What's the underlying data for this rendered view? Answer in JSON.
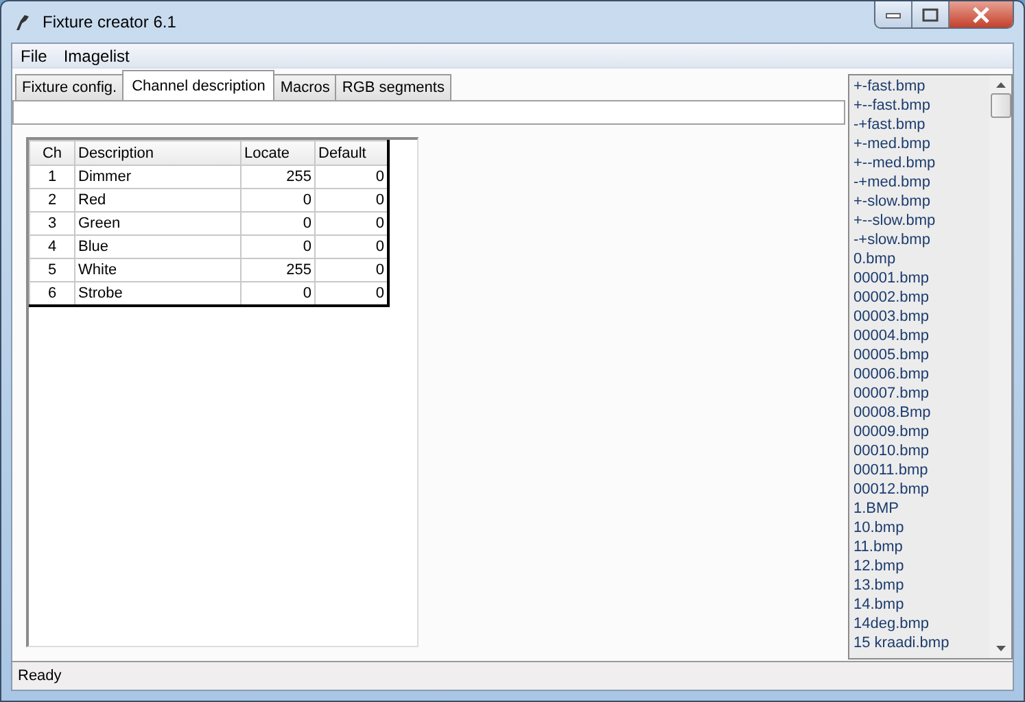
{
  "window": {
    "title": "Fixture creator 6.1"
  },
  "menu": [
    "File",
    "Imagelist"
  ],
  "tabs": [
    {
      "label": "Fixture config.",
      "selected": false
    },
    {
      "label": "Channel description",
      "selected": true
    },
    {
      "label": "Macros",
      "selected": false
    },
    {
      "label": "RGB segments",
      "selected": false
    }
  ],
  "table": {
    "columns": [
      "Ch",
      "Description",
      "Locate",
      "Default"
    ],
    "rows": [
      [
        "1",
        "Dimmer",
        "255",
        "0"
      ],
      [
        "2",
        "Red",
        "0",
        "0"
      ],
      [
        "3",
        "Green",
        "0",
        "0"
      ],
      [
        "4",
        "Blue",
        "0",
        "0"
      ],
      [
        "5",
        "White",
        "255",
        "0"
      ],
      [
        "6",
        "Strobe",
        "0",
        "0"
      ]
    ]
  },
  "imagelist": [
    "+-fast.bmp",
    "+--fast.bmp",
    "-+fast.bmp",
    "+-med.bmp",
    "+--med.bmp",
    "-+med.bmp",
    "+-slow.bmp",
    "+--slow.bmp",
    "-+slow.bmp",
    "0.bmp",
    "00001.bmp",
    "00002.bmp",
    "00003.bmp",
    "00004.bmp",
    "00005.bmp",
    "00006.bmp",
    "00007.bmp",
    "00008.Bmp",
    "00009.bmp",
    "00010.bmp",
    "00011.bmp",
    "00012.bmp",
    "1.BMP",
    "10.bmp",
    "11.bmp",
    "12.bmp",
    "13.bmp",
    "14.bmp",
    "14deg.bmp",
    "15 kraadi.bmp"
  ],
  "status_bar": "Ready"
}
